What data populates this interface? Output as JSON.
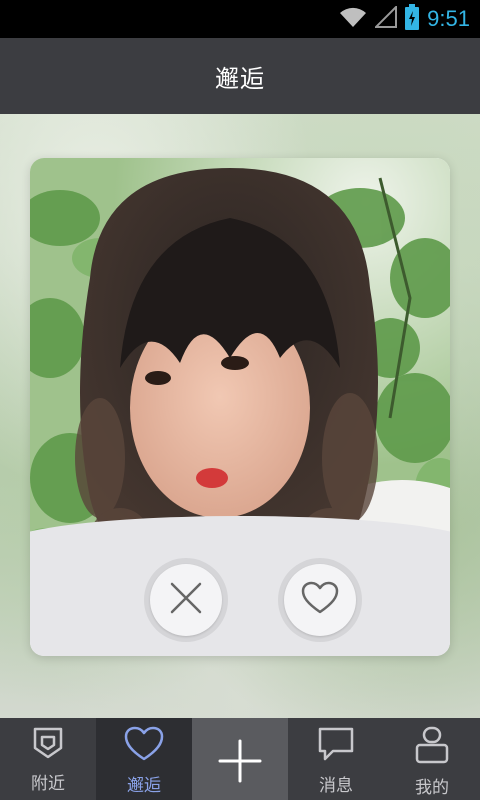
{
  "status_bar": {
    "time": "9:51"
  },
  "header": {
    "title": "邂逅"
  },
  "card": {
    "pass_icon": "close-icon",
    "like_icon": "heart-icon"
  },
  "bottom_nav": {
    "items": [
      {
        "label": "附近",
        "icon": "shield-icon",
        "active": false
      },
      {
        "label": "邂逅",
        "icon": "heart-icon",
        "active": true
      },
      {
        "label": "",
        "icon": "plus-icon",
        "active": false
      },
      {
        "label": "消息",
        "icon": "chat-bubble-icon",
        "active": false
      },
      {
        "label": "我的",
        "icon": "profile-icon",
        "active": false
      }
    ]
  },
  "colors": {
    "accent": "#8aa2e8",
    "status_time": "#33b5e5",
    "bar": "#3c3d41"
  }
}
